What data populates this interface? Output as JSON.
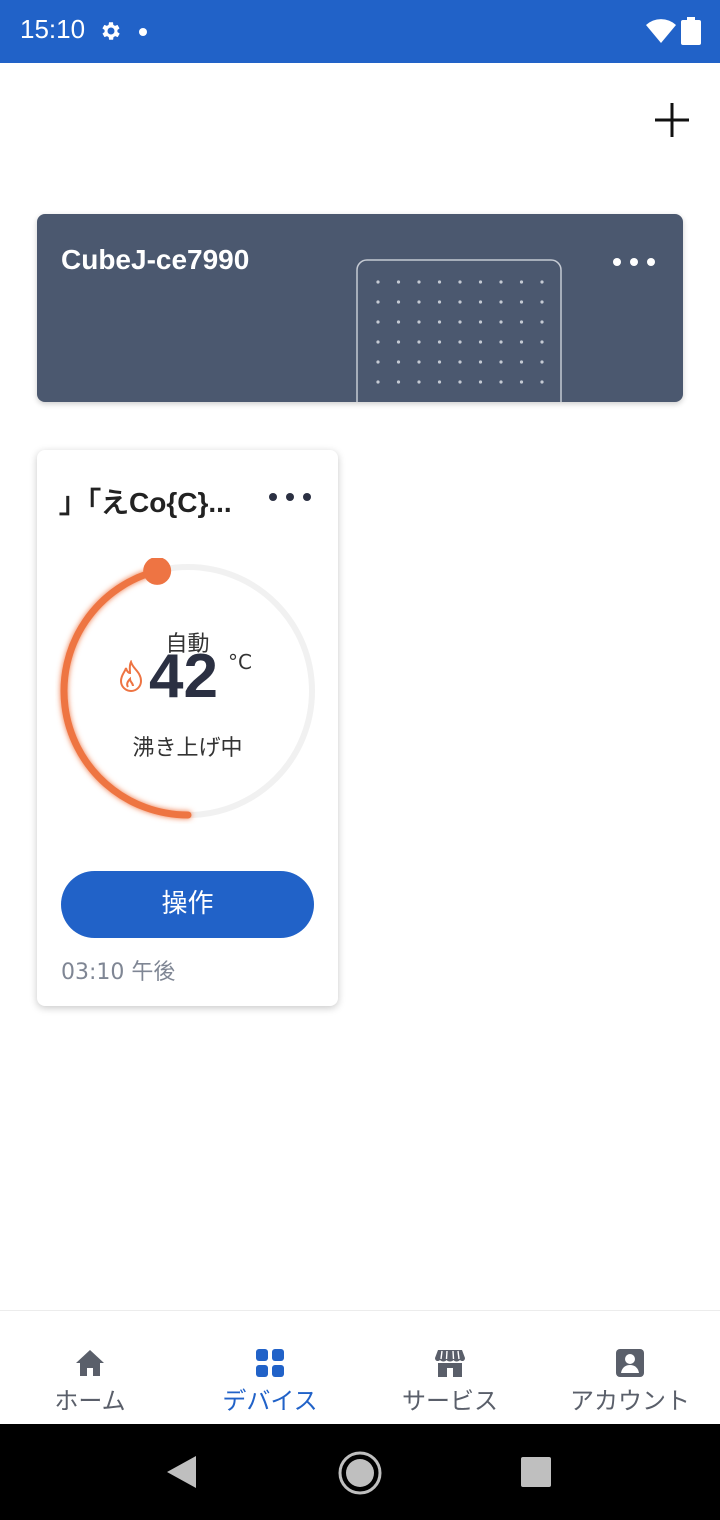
{
  "status_bar": {
    "time": "15:10",
    "icons": [
      "gear-icon",
      "dot-icon",
      "wifi-icon",
      "battery-icon"
    ]
  },
  "header": {
    "add_icon": "plus-icon"
  },
  "gateway_card": {
    "name": "CubeJ-ce7990",
    "more_icon": "more-horizontal-icon",
    "background_color": "#4b586f"
  },
  "device_card": {
    "title": "」「えCo{C}...",
    "more_icon": "more-horizontal-icon",
    "mode": "自動",
    "temperature": "42",
    "unit": "°C",
    "status": "沸き上げ中",
    "gauge_fraction": 0.5,
    "gauge_color": "#ee7443",
    "button_label": "操作",
    "timestamp": "03:10 午後"
  },
  "bottom_nav": {
    "items": [
      {
        "label": "ホーム",
        "icon": "home-icon",
        "active": false
      },
      {
        "label": "デバイス",
        "icon": "grid-icon",
        "active": true
      },
      {
        "label": "サービス",
        "icon": "store-icon",
        "active": false
      },
      {
        "label": "アカウント",
        "icon": "account-icon",
        "active": false
      }
    ]
  },
  "colors": {
    "accent": "#2162c8",
    "orange": "#ee7443"
  }
}
